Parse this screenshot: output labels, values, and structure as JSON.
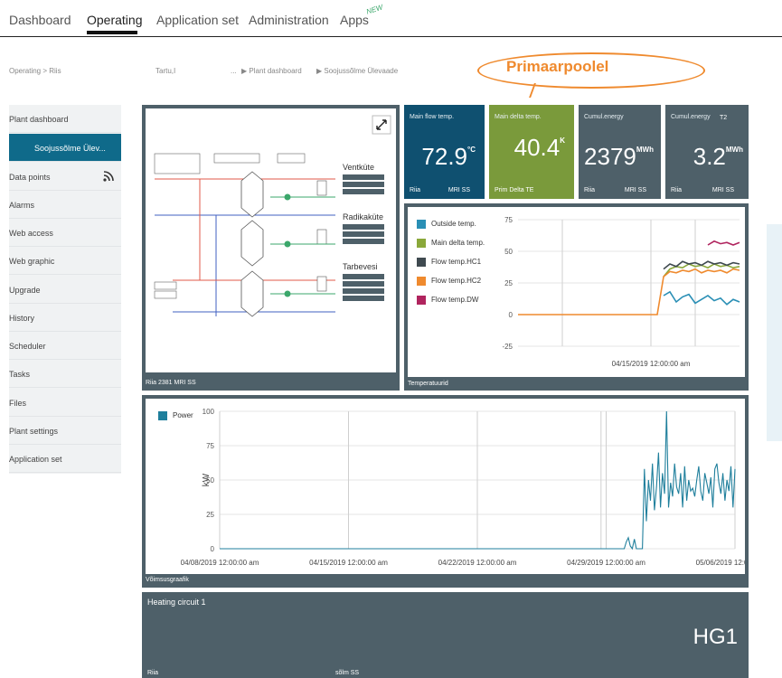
{
  "nav": {
    "tabs": [
      {
        "label": "Dashboard"
      },
      {
        "label": "Operating"
      },
      {
        "label": "Application set"
      },
      {
        "label": "Administration"
      },
      {
        "label": "Apps"
      }
    ],
    "apps_badge": "NEW"
  },
  "breadcrumb": {
    "section": "Operating  >  Riis",
    "site": "Tartu,I",
    "ellipsis": "...",
    "plant_dashboard": "▶  Plant dashboard",
    "current": "▶  Soojussõlme Ülevaade"
  },
  "callout": "Primaarpoolel",
  "sidebar": {
    "items": [
      {
        "label": "Plant dashboard"
      },
      {
        "label": "Soojussõlme Ülev..."
      },
      {
        "label": "Data points"
      },
      {
        "label": "Alarms"
      },
      {
        "label": "Web access"
      },
      {
        "label": "Web graphic"
      },
      {
        "label": "Upgrade"
      },
      {
        "label": "History"
      },
      {
        "label": "Scheduler"
      },
      {
        "label": "Tasks"
      },
      {
        "label": "Files"
      },
      {
        "label": "Plant settings"
      },
      {
        "label": "Application set"
      }
    ]
  },
  "graphic_panel": {
    "footer": "Riia 2381 MRI SS",
    "sections": [
      "Ventküte",
      "Radikaküte",
      "Tarbevesi"
    ]
  },
  "kpis": [
    {
      "title": "Main flow temp.",
      "value": "72.9",
      "unit": "°C",
      "foot_left": "Riia",
      "foot_right": "MRI SS",
      "color": "#0f5070"
    },
    {
      "title": "Main delta temp.",
      "value": "40.4",
      "unit": "K",
      "foot_left": "Prim Delta TE",
      "foot_right": "",
      "color": "#7a9a3b"
    },
    {
      "title": "Cumul.energy",
      "value": "2379",
      "unit": "MWh",
      "foot_left": "Riia",
      "foot_right": "MRI SS",
      "color": "#4e6069"
    },
    {
      "title": "Cumul.energy",
      "sub": "T2",
      "value": "3.2",
      "unit": "MWh",
      "foot_left": "Riia",
      "foot_right": "MRI SS",
      "color": "#4e6069"
    }
  ],
  "temp_chart_panel": {
    "footer": "Temperatuurid"
  },
  "power_chart_panel": {
    "footer": "Võimsusgraafik"
  },
  "heating_circuit": {
    "title": "Heating circuit 1",
    "code": "HG1",
    "foot_left": "Riia",
    "foot_right": "sõlm SS"
  },
  "chart_data": [
    {
      "type": "line",
      "title": "",
      "xlabel": "",
      "ylabel": "",
      "ylim": [
        -25,
        75
      ],
      "yticks": [
        75,
        50,
        25,
        0,
        -25
      ],
      "x_tick_labels": [
        "04/15/2019 12:00:00 am"
      ],
      "series": [
        {
          "name": "Outside temp.",
          "color": "#2a8fb5",
          "values": [
            null,
            null,
            null,
            null,
            null,
            null,
            null,
            null,
            null,
            null,
            null,
            null,
            null,
            null,
            null,
            null,
            null,
            null,
            null,
            null,
            null,
            null,
            null,
            15,
            18,
            10,
            14,
            16,
            9,
            12,
            15,
            11,
            13,
            8,
            12,
            10
          ]
        },
        {
          "name": "Main delta temp.",
          "color": "#8aa83a",
          "values": [
            null,
            null,
            null,
            null,
            null,
            null,
            null,
            null,
            null,
            null,
            null,
            null,
            null,
            null,
            null,
            null,
            null,
            null,
            null,
            null,
            null,
            null,
            null,
            30,
            36,
            38,
            37,
            40,
            38,
            39,
            37,
            40,
            38,
            39,
            37,
            38
          ]
        },
        {
          "name": "Flow temp.HC1",
          "color": "#3f4a50",
          "values": [
            null,
            null,
            null,
            null,
            null,
            null,
            null,
            null,
            null,
            null,
            null,
            null,
            null,
            null,
            null,
            null,
            null,
            null,
            null,
            null,
            null,
            null,
            null,
            36,
            40,
            38,
            42,
            40,
            41,
            39,
            42,
            40,
            41,
            39,
            41,
            40
          ]
        },
        {
          "name": "Flow temp.HC2",
          "color": "#ef8a2e",
          "values": [
            0,
            0,
            0,
            0,
            0,
            0,
            0,
            0,
            0,
            0,
            0,
            0,
            0,
            0,
            0,
            0,
            0,
            0,
            0,
            0,
            0,
            0,
            0,
            30,
            34,
            33,
            35,
            34,
            36,
            33,
            35,
            34,
            35,
            33,
            36,
            35
          ]
        },
        {
          "name": "Flow temp.DW",
          "color": "#b0245e",
          "values": [
            null,
            null,
            null,
            null,
            null,
            null,
            null,
            null,
            null,
            null,
            null,
            null,
            null,
            null,
            null,
            null,
            null,
            null,
            null,
            null,
            null,
            null,
            null,
            null,
            null,
            null,
            null,
            null,
            null,
            null,
            55,
            58,
            56,
            57,
            55,
            57
          ]
        }
      ]
    },
    {
      "type": "line",
      "title": "",
      "xlabel": "",
      "ylabel": "kW",
      "ylim": [
        0,
        100
      ],
      "yticks": [
        100,
        75,
        50,
        25,
        0
      ],
      "x_tick_labels": [
        "04/08/2019 12:00:00 am",
        "04/15/2019 12:00:00 am",
        "04/22/2019 12:00:00 am",
        "04/29/2019 12:00:00 am",
        "05/06/2019 12:00:00 am"
      ],
      "series": [
        {
          "name": "Power",
          "color": "#1f7f9c",
          "values": [
            0,
            0,
            0,
            0,
            0,
            0,
            0,
            0,
            0,
            0,
            0,
            0,
            0,
            0,
            0,
            0,
            0,
            0,
            0,
            0,
            0,
            0,
            0,
            0,
            0,
            0,
            0,
            0,
            0,
            0,
            0,
            0,
            0,
            0,
            0,
            0,
            0,
            0,
            0,
            0,
            0,
            0,
            0,
            0,
            0,
            0,
            0,
            0,
            0,
            0,
            0,
            0,
            0,
            0,
            0,
            0,
            0,
            0,
            0,
            0,
            0,
            0,
            0,
            0,
            0,
            0,
            0,
            0,
            0,
            0,
            0,
            0,
            0,
            0,
            0,
            0,
            0,
            0,
            0,
            0,
            0,
            0,
            0,
            0,
            0,
            0,
            0,
            0,
            0,
            0,
            0,
            0,
            0,
            0,
            0,
            0,
            0,
            0,
            0,
            0,
            0,
            0,
            0,
            0,
            0,
            0,
            0,
            0,
            0,
            0,
            0,
            0,
            0,
            0,
            0,
            0,
            0,
            0,
            0,
            0,
            0,
            0,
            0,
            0,
            0,
            0,
            0,
            0,
            0,
            0,
            0,
            0,
            0,
            0,
            0,
            0,
            0,
            0,
            0,
            0,
            0,
            0,
            0,
            0,
            0,
            0,
            0,
            0,
            0,
            0,
            0,
            0,
            0,
            0,
            0,
            0,
            0,
            0,
            0,
            0,
            0,
            0,
            0,
            0,
            0,
            0,
            0,
            0,
            0,
            0,
            0,
            0,
            0,
            0,
            0,
            0,
            0,
            0,
            0,
            0,
            0,
            0,
            0,
            0,
            0,
            0,
            0,
            0,
            0,
            0,
            0,
            0,
            0,
            0,
            0,
            0,
            0,
            0,
            0,
            0,
            0,
            0,
            5,
            8,
            2,
            0,
            7,
            0,
            0,
            0,
            0,
            58,
            20,
            50,
            35,
            62,
            28,
            45,
            70,
            30,
            55,
            40,
            100,
            30,
            48,
            38,
            62,
            45,
            40,
            55,
            30,
            60,
            35,
            50,
            42,
            44,
            38,
            50,
            60,
            42,
            35,
            55,
            48,
            40,
            52,
            30,
            58,
            62,
            48,
            40,
            55,
            35,
            50,
            42,
            60,
            30,
            58
          ]
        }
      ]
    }
  ]
}
